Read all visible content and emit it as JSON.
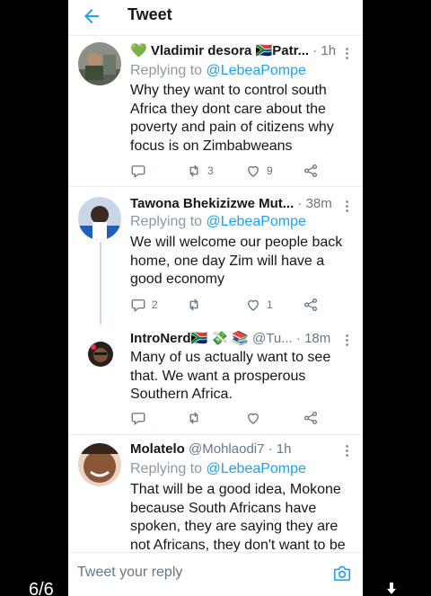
{
  "header": {
    "title": "Tweet"
  },
  "tweets": [
    {
      "name": "💚 Vladimir desora 🇿🇦Patr...",
      "handle": "",
      "time": "· 1h",
      "replying_prefix": "Replying to",
      "replying_to": "@LebeaPompe",
      "text": "Why they want to control south Africa they dont care about the poverty and pain of citizens why focus is on Zimbabweans",
      "reply_count": "",
      "retweet_count": "3",
      "like_count": "9"
    },
    {
      "name": "Tawona Bhekizizwe Mut...",
      "handle": "",
      "time": "· 38m",
      "replying_prefix": "Replying to",
      "replying_to": "@LebeaPompe",
      "text": "We will welcome our people back home, one day Zim will have a good economy",
      "reply_count": "2",
      "retweet_count": "",
      "like_count": "1"
    },
    {
      "name": "IntroNerd🇿🇦 💸 📚",
      "handle": "@Tu...",
      "time": "· 18m",
      "replying_prefix": "",
      "replying_to": "",
      "text": "Many of us actually want to see that. We want a prosperous Southern Africa.",
      "reply_count": "",
      "retweet_count": "",
      "like_count": ""
    },
    {
      "name": "Molatelo",
      "handle": "@Mohlaodi7",
      "time": "· 1h",
      "replying_prefix": "Replying to",
      "replying_to": "@LebeaPompe",
      "text": "That will be a good idea, Mokone because South Africans have spoken, they are saying they are not Africans, they don't want to be part",
      "reply_count": "",
      "retweet_count": "",
      "like_count": ""
    }
  ],
  "composer": {
    "placeholder": "Tweet your reply"
  },
  "pager": {
    "text": "6/6"
  },
  "colors": {
    "accent": "#1da1f2",
    "muted": "#657786",
    "text": "#14171a"
  },
  "icons": {
    "back": "arrow-left-icon",
    "reply": "reply-icon",
    "retweet": "retweet-icon",
    "like": "heart-icon",
    "share": "share-icon",
    "more": "more-vertical-icon",
    "camera": "camera-icon",
    "download": "download-icon"
  }
}
